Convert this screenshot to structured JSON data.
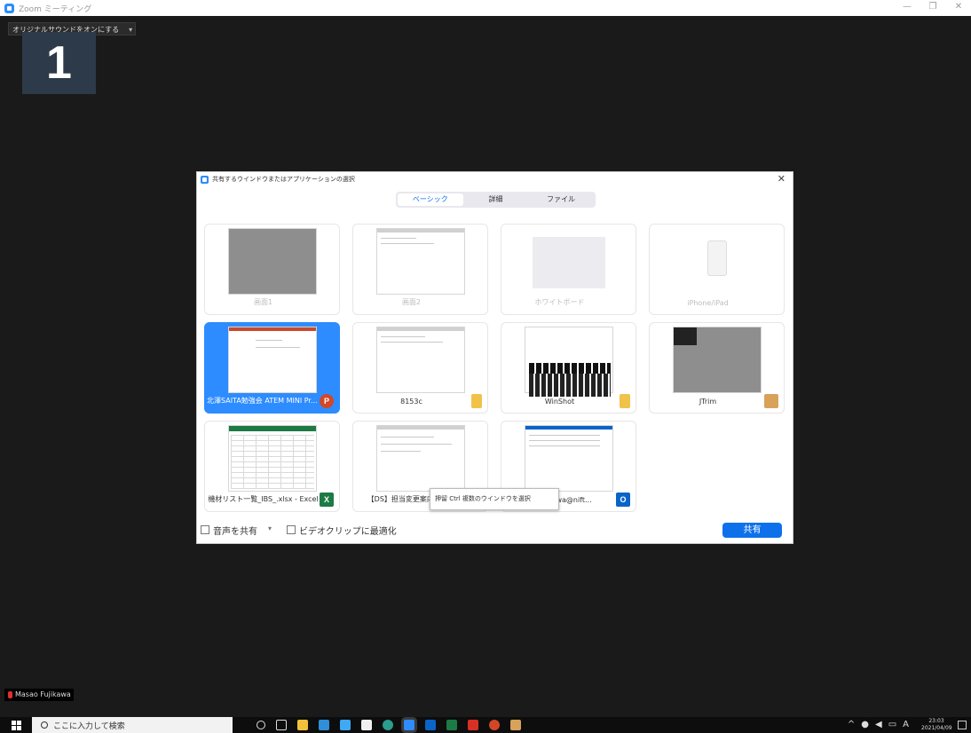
{
  "window": {
    "title": "Zoom ミーティング"
  },
  "meeting": {
    "original_sound_label": "オリジナルサウンドをオンにする",
    "tile_number": "1",
    "participant_name": "Masao Fujikawa"
  },
  "dialog": {
    "title": "共有するウインドウまたはアプリケーションの選択",
    "tabs": [
      "ベーシック",
      "詳細",
      "ファイル"
    ],
    "active_tab": "ベーシック",
    "tiles": [
      {
        "label": "画面1"
      },
      {
        "label": "画面2"
      },
      {
        "label": "ホワイトボード"
      },
      {
        "label": "iPhone/iPad"
      },
      {
        "label": "北澤SAITA勉強会 ATEM MINI Pr...",
        "app": "P"
      },
      {
        "label": "8153c"
      },
      {
        "label": "WinShot"
      },
      {
        "label": "JTrim"
      },
      {
        "label": "機材リスト一覧_IBS_.xlsx - Excel",
        "app": "X"
      },
      {
        "label": "【DS】担当変更案内_IBS..."
      },
      {
        "label": "m.fujikawa@nift...",
        "app": "O"
      }
    ],
    "tooltip": "押留 Ctrl 複数のウインドウを選択",
    "footer": {
      "share_audio_label": "音声を共有",
      "optimize_video_label": "ビデオクリップに最適化",
      "share_button": "共有"
    }
  },
  "taskbar": {
    "search_placeholder": "ここに入力して検索",
    "time": "23:03",
    "date": "2021/04/09",
    "ime": "A"
  }
}
